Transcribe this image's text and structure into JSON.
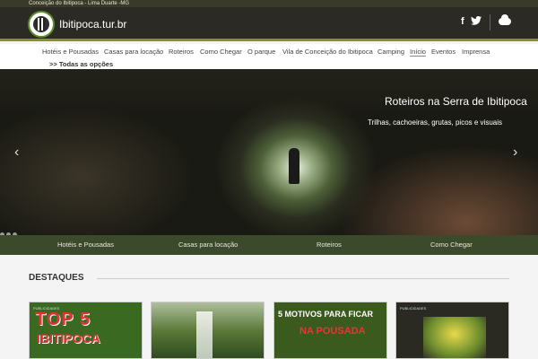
{
  "topbar": {
    "location": "Conceição do Ibitipoca - Lima Duarte -MG"
  },
  "header": {
    "site_name": "Ibitipoca.tur.br",
    "facebook_icon": "f",
    "twitter_icon": "twitter-icon",
    "cloud_icon": "cloud-icon"
  },
  "nav": {
    "items": [
      {
        "label": "Hotéis e Pousadas"
      },
      {
        "label": "Casas para locação"
      },
      {
        "label": "Roteiros"
      },
      {
        "label": "Como Chegar"
      },
      {
        "label": "O parque"
      },
      {
        "label": "Vila de Conceição do Ibitipoca"
      },
      {
        "label": "Camping"
      },
      {
        "label": "Início"
      },
      {
        "label": "Eventos"
      },
      {
        "label": "Imprensa"
      }
    ],
    "all_options": ">> Todas as opções"
  },
  "hero": {
    "title": "Roteiros na Serra de Ibitipoca",
    "subtitle": "Trilhas, cachoeiras, grutas, picos e visuais",
    "prev_arrow": "‹",
    "next_arrow": "›"
  },
  "subnav": {
    "items": [
      {
        "label": "Hotéis e Pousadas"
      },
      {
        "label": "Casas para locação"
      },
      {
        "label": "Roteiros"
      },
      {
        "label": "Como Chegar"
      }
    ]
  },
  "section": {
    "title": "DESTAQUES"
  },
  "cards": [
    {
      "tag": "PUBLICIDADES",
      "top": "TOP 5",
      "bottom": "IBITIPOCA"
    },
    {},
    {
      "top": "5 MOTIVOS PARA FICAR",
      "bottom": "NA POUSADA"
    },
    {
      "tag": "PUBLICIDADES"
    }
  ]
}
